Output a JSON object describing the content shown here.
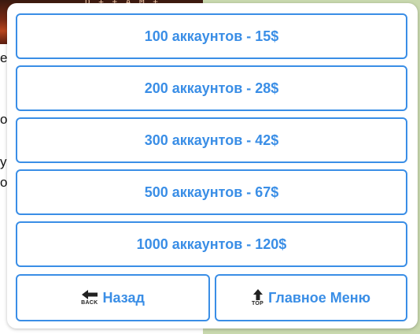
{
  "background": {
    "image_caption": "D + ± A M ±",
    "left_fragments": [
      "e",
      "o",
      "y",
      "o"
    ]
  },
  "keyboard": {
    "options": [
      {
        "label": "100 аккаунтов - 15$"
      },
      {
        "label": "200 аккаунтов - 28$"
      },
      {
        "label": "300 аккаунтов - 42$"
      },
      {
        "label": "500 аккаунтов - 67$"
      },
      {
        "label": "1000 аккаунтов - 120$"
      }
    ],
    "back": {
      "label": "Назад",
      "icon": "back-arrow-icon",
      "icon_caption": "BACK"
    },
    "main_menu": {
      "label": "Главное Меню",
      "icon": "top-arrow-icon",
      "icon_caption": "TOP"
    }
  },
  "colors": {
    "accent": "#3a8ee6",
    "panel": "#ffffff",
    "wallpaper": "#c9d9ae"
  }
}
